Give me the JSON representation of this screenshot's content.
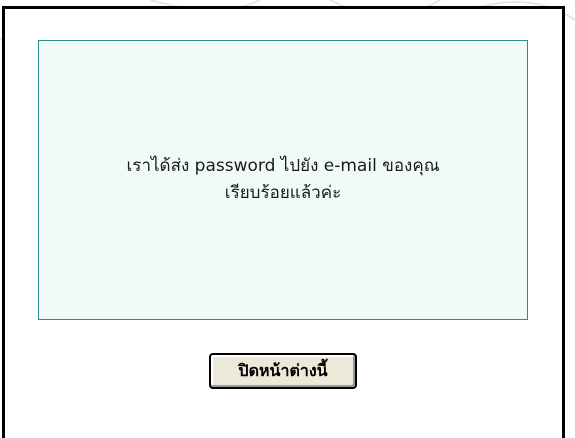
{
  "message": {
    "line1": "เราได้ส่ง password ไปยัง e-mail ของคุณ",
    "line2": "เรียบร้อยแล้วค่ะ"
  },
  "actions": {
    "close_label": "ปิดหน้าต่างนี้"
  },
  "colors": {
    "panel_background": "#f1fbf5",
    "panel_border": "#2e8b8b",
    "frame_border": "#000000",
    "button_face": "#ece9d8"
  }
}
